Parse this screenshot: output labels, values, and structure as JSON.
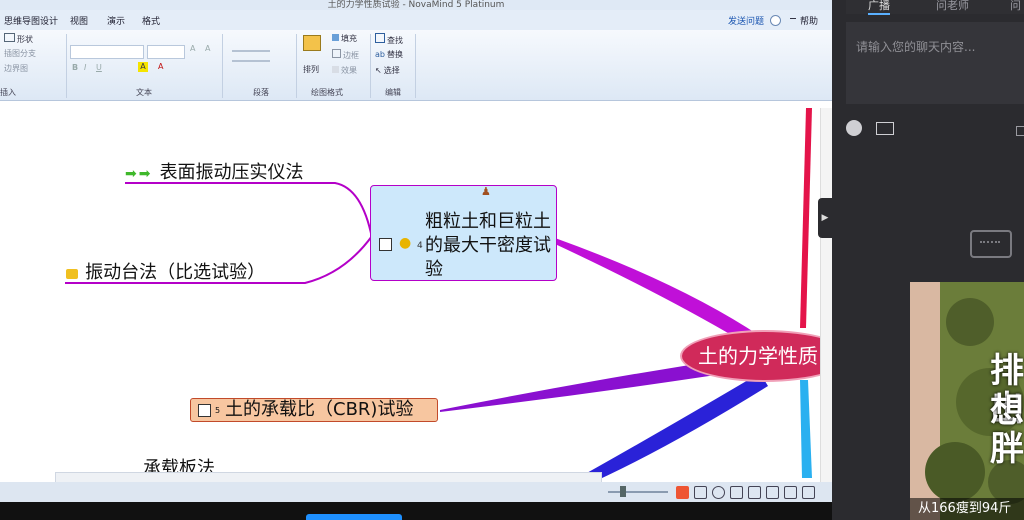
{
  "window": {
    "title": "土的力学性质试验 - NovaMind 5 Platinum"
  },
  "menu": {
    "items": [
      "思维导图设计",
      "视图",
      "演示",
      "格式"
    ],
    "help": "帮助",
    "feedback": "发送问题"
  },
  "ribbon": {
    "insert_buttons": [
      "形状",
      "插图分支",
      "边界图"
    ],
    "arrange_label": "排列",
    "fill_label": "填充",
    "border_label": "边框",
    "effect_label": "效果",
    "find_label": "查找",
    "replace_label": "替换",
    "select_label": "选择",
    "group_labels": {
      "insert": "插入",
      "text": "文本",
      "paragraph": "段落",
      "draw": "绘图格式",
      "edit": "编辑"
    }
  },
  "mindmap": {
    "root": "土的力学性质",
    "topic_coarse": "粗粒土和巨粒土的最大干密度试验",
    "coarse_number": "4",
    "branch_surface": "表面振动压实仪法",
    "branch_table": "振动台法（比选试验）",
    "topic_cbr": "土的承载比（CBR)试验",
    "cbr_number": "5",
    "branch_plate": "承载板法"
  },
  "sidebar": {
    "tabs": [
      "广播",
      "问老师",
      "问"
    ],
    "chat_placeholder": "请输入您的聊天内容...",
    "ad_text_1": "排出",
    "ad_text_2": "想胖",
    "ad_caption": "从166瘦到94斤",
    "collapse_icon": "▶"
  },
  "colors": {
    "root_fill": "#d02a5a",
    "topic_fill": "#cde8fb",
    "cbr_fill": "#f7c6a0",
    "branch_purple": "#b400c8",
    "branch_blue": "#3a2ad8"
  }
}
